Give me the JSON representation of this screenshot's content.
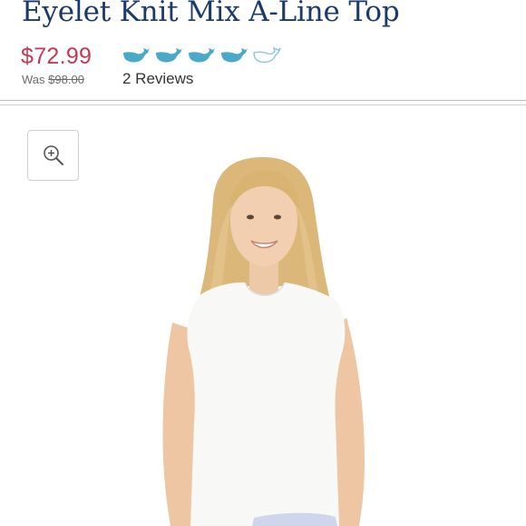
{
  "product": {
    "title": "Eyelet Knit Mix A-Line Top",
    "price": "$72.99",
    "was_label": "Was",
    "was_price": "$98.00",
    "reviews_text": "2 Reviews",
    "rating": {
      "value": 4,
      "max": 5,
      "icon": "whale-icon"
    }
  },
  "colors": {
    "title": "#1b3a6b",
    "price": "#c33a55",
    "rating_filled": "#4aa8c8",
    "rating_empty": "#8cc7dd"
  },
  "gallery": {
    "zoom_icon": "zoom-in-icon"
  }
}
